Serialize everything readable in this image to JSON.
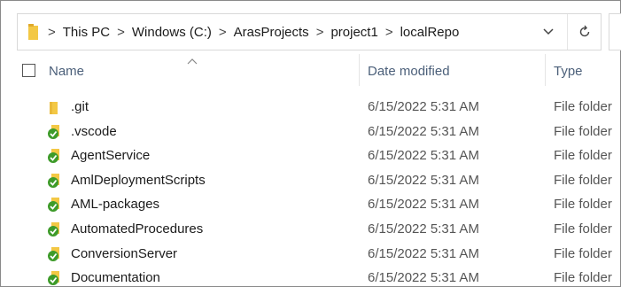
{
  "address_bar": {
    "breadcrumbs": [
      "This PC",
      "Windows (C:)",
      "ArasProjects",
      "project1",
      "localRepo"
    ],
    "separator": ">",
    "dropdown_icon": "chevron-down-icon",
    "refresh_icon": "refresh-icon"
  },
  "columns": {
    "name": "Name",
    "date_modified": "Date modified",
    "type": "Type",
    "sorted_by": "name"
  },
  "files": [
    {
      "name": ".git",
      "date_modified": "6/15/2022 5:31 AM",
      "type": "File folder",
      "icon": "plain-folder-icon"
    },
    {
      "name": ".vscode",
      "date_modified": "6/15/2022 5:31 AM",
      "type": "File folder",
      "icon": "synced-check-icon"
    },
    {
      "name": "AgentService",
      "date_modified": "6/15/2022 5:31 AM",
      "type": "File folder",
      "icon": "synced-check-icon"
    },
    {
      "name": "AmlDeploymentScripts",
      "date_modified": "6/15/2022 5:31 AM",
      "type": "File folder",
      "icon": "synced-check-icon"
    },
    {
      "name": "AML-packages",
      "date_modified": "6/15/2022 5:31 AM",
      "type": "File folder",
      "icon": "synced-check-icon"
    },
    {
      "name": "AutomatedProcedures",
      "date_modified": "6/15/2022 5:31 AM",
      "type": "File folder",
      "icon": "synced-check-icon"
    },
    {
      "name": "ConversionServer",
      "date_modified": "6/15/2022 5:31 AM",
      "type": "File folder",
      "icon": "synced-check-icon"
    },
    {
      "name": "Documentation",
      "date_modified": "6/15/2022 5:31 AM",
      "type": "File folder",
      "icon": "synced-check-icon"
    }
  ],
  "colors": {
    "folder_yellow": "#f3c845",
    "check_green": "#3e9b2a",
    "header_text": "#4c607a"
  }
}
